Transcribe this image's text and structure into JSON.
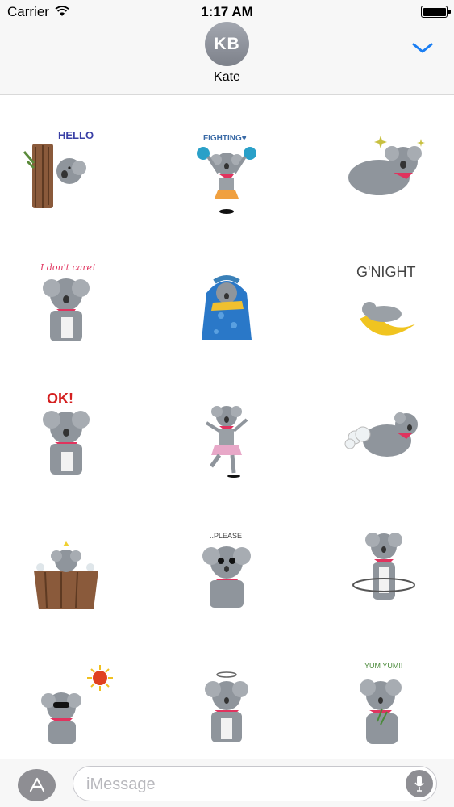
{
  "status_bar": {
    "carrier": "Carrier",
    "time": "1:17 AM"
  },
  "contact": {
    "initials": "KB",
    "name": "Kate"
  },
  "colors": {
    "accent": "#1a7ef3",
    "koala_fur": "#8f959c",
    "scarf": "#e0335e",
    "bar_bg": "#f7f7f7"
  },
  "stickers": [
    {
      "caption": "HELLO",
      "name": "koala-hello"
    },
    {
      "caption": "FIGHTING♥",
      "name": "koala-fighting"
    },
    {
      "caption": "",
      "name": "koala-lying"
    },
    {
      "caption": "I don't care!",
      "name": "koala-dont-care"
    },
    {
      "caption": "",
      "name": "koala-blanket"
    },
    {
      "caption": "G'NIGHT",
      "name": "koala-gnight"
    },
    {
      "caption": "OK!",
      "name": "koala-ok"
    },
    {
      "caption": "",
      "name": "koala-dance"
    },
    {
      "caption": "",
      "name": "koala-fart"
    },
    {
      "caption": "",
      "name": "koala-bath"
    },
    {
      "caption": "..PLEASE",
      "name": "koala-please"
    },
    {
      "caption": "",
      "name": "koala-hula-hoop"
    },
    {
      "caption": "",
      "name": "koala-sunny"
    },
    {
      "caption": "",
      "name": "koala-angel"
    },
    {
      "caption": "YUM YUM!!",
      "name": "koala-yum"
    }
  ],
  "compose": {
    "placeholder": "iMessage",
    "app_store_icon": "app-store-icon",
    "mic_icon": "microphone-icon"
  }
}
